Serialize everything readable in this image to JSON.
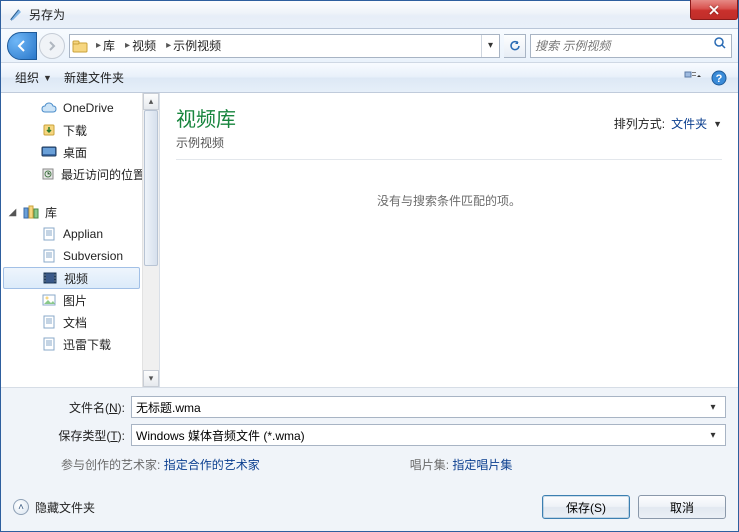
{
  "window": {
    "title": "另存为"
  },
  "address": {
    "segments": [
      "库",
      "视频",
      "示例视频"
    ]
  },
  "search": {
    "placeholder": "搜索 示例视频"
  },
  "toolbar": {
    "organize": "组织",
    "new_folder": "新建文件夹"
  },
  "tree": {
    "onedrive": "OneDrive",
    "downloads": "下载",
    "desktop": "桌面",
    "recent": "最近访问的位置",
    "libraries": "库",
    "applian": "Applian",
    "subversion": "Subversion",
    "videos": "视频",
    "pictures": "图片",
    "documents": "文档",
    "xunlei": "迅雷下载"
  },
  "content": {
    "library_title": "视频库",
    "library_subtitle": "示例视频",
    "sort_label": "排列方式:",
    "sort_value": "文件夹",
    "empty_message": "没有与搜索条件匹配的项。"
  },
  "fields": {
    "filename_label_pre": "文件名(",
    "filename_label_key": "N",
    "filename_label_post": "):",
    "filename_value": "无标题.wma",
    "filetype_label_pre": "保存类型(",
    "filetype_label_key": "T",
    "filetype_label_post": "):",
    "filetype_value": "Windows 媒体音频文件 (*.wma)"
  },
  "meta": {
    "artist_label": "参与创作的艺术家:",
    "artist_link": "指定合作的艺术家",
    "album_label": "唱片集:",
    "album_link": "指定唱片集"
  },
  "footer": {
    "hide_folders": "隐藏文件夹",
    "save": "保存(S)",
    "cancel": "取消"
  }
}
